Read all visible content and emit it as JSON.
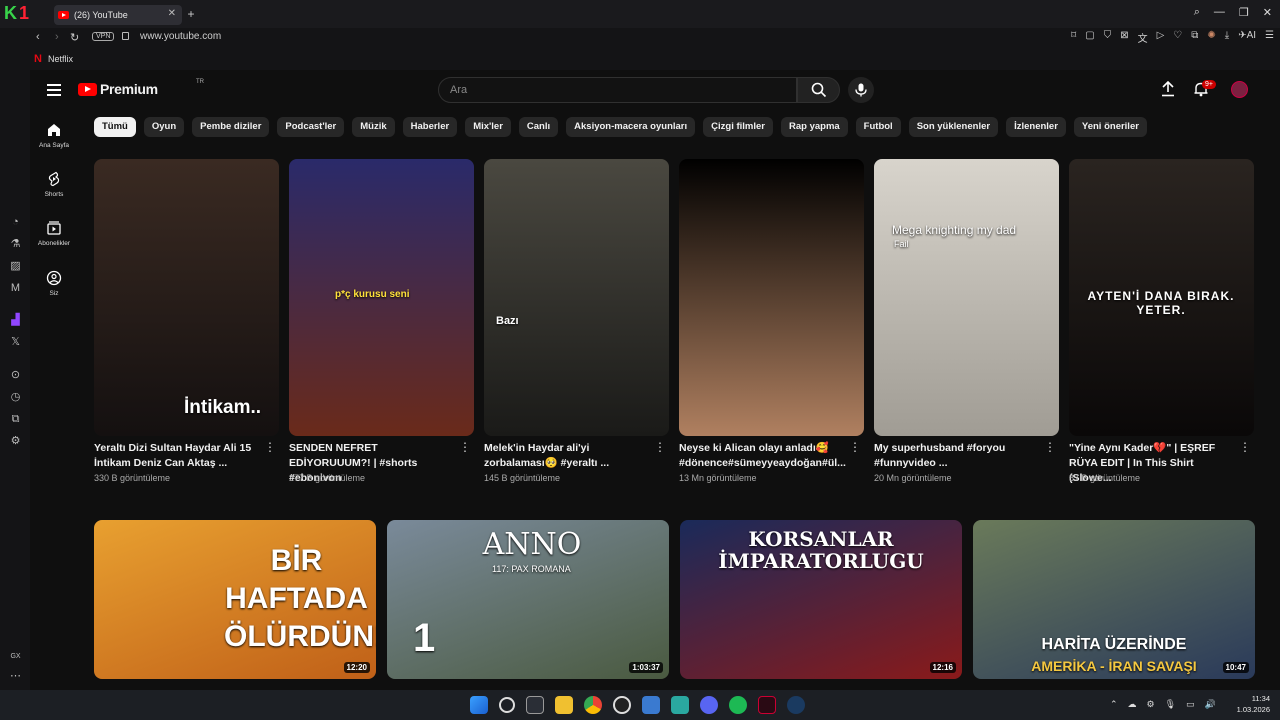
{
  "browser": {
    "tab_title": "(26) YouTube",
    "url": "www.youtube.com",
    "vpn_label": "VPN",
    "bookmark_netflix": "Netflix",
    "gx_sidebar_label": "GX"
  },
  "header": {
    "brand": "Premium",
    "region": "TR",
    "search_placeholder": "Ara",
    "notification_count": "9+"
  },
  "nav": [
    {
      "label": "Ana Sayfa",
      "icon": "home-icon"
    },
    {
      "label": "Shorts",
      "icon": "shorts-icon"
    },
    {
      "label": "Abonelikler",
      "icon": "subscriptions-icon"
    },
    {
      "label": "Siz",
      "icon": "user-icon"
    }
  ],
  "chips": [
    "Tümü",
    "Oyun",
    "Pembe diziler",
    "Podcast'ler",
    "Müzik",
    "Haberler",
    "Mix'ler",
    "Canlı",
    "Aksiyon-macera oyunları",
    "Çizgi filmler",
    "Rap yapma",
    "Futbol",
    "Son yüklenenler",
    "İzlenenler",
    "Yeni öneriler"
  ],
  "shorts": [
    {
      "title": "Yeraltı Dizi Sultan Haydar Ali 15 İntikam Deniz Can Aktaş ...",
      "views": "330 B görüntüleme",
      "overlay": "İntikam..",
      "colors": [
        "#3a2a22",
        "#141010"
      ]
    },
    {
      "title": "SENDEN NEFRET EDİYORUUUM?! | #shorts #ebonivon",
      "views": "277 B görüntüleme",
      "overlay": "p*ç kurusu seni",
      "colors": [
        "#2a2a6a",
        "#6a2a1a"
      ]
    },
    {
      "title": "Melek'in Haydar ali'yi zorbalaması🥺 #yeraltı ...",
      "views": "145 B görüntüleme",
      "overlay": "Bazı",
      "colors": [
        "#4a4840",
        "#1a1a18"
      ]
    },
    {
      "title": "Neyse ki Alican olayı anladı🥰 #dönence#sümeyyeaydoğan#ül...",
      "views": "13 Mn görüntüleme",
      "overlay": "",
      "colors": [
        "#000000",
        "#b08060"
      ]
    },
    {
      "title": "My superhusband #foryou #funnyvideo ...",
      "views": "20 Mn görüntüleme",
      "overlay": "Mega knighting my dad",
      "overlay2": "Fail",
      "colors": [
        "#d8d4cc",
        "#a09c94"
      ]
    },
    {
      "title": "\"Yine Aynı Kader💔\" | EŞREF RÜYA EDIT | In This Shirt (Slowe...",
      "views": "87 B görüntüleme",
      "overlay": "AYTEN'İ DANA BIRAK. YETER.",
      "colors": [
        "#2a2420",
        "#0a0808"
      ]
    }
  ],
  "videos": [
    {
      "duration": "12:20",
      "overlay": "BİR HAFTADA ÖLÜRDÜN!",
      "colors": [
        "#e8a030",
        "#c06018"
      ]
    },
    {
      "duration": "1:03:37",
      "overlay": "ANNO",
      "overlay2": "117: PAX ROMANA",
      "overlay3": "1",
      "colors": [
        "#7a8a9a",
        "#4a5a40"
      ]
    },
    {
      "duration": "12:16",
      "overlay": "KORSANLAR İMPARATORLUGU",
      "colors": [
        "#1a2a5a",
        "#8a1a1a"
      ]
    },
    {
      "duration": "10:47",
      "overlay": "HARİTA ÜZERİNDE",
      "overlay2": "AMERİKA - İRAN SAVAŞI",
      "colors": [
        "#6a7a5a",
        "#2a3a5a"
      ]
    }
  ],
  "taskbar": {
    "time": "11:34",
    "date": "1.03.2026"
  }
}
